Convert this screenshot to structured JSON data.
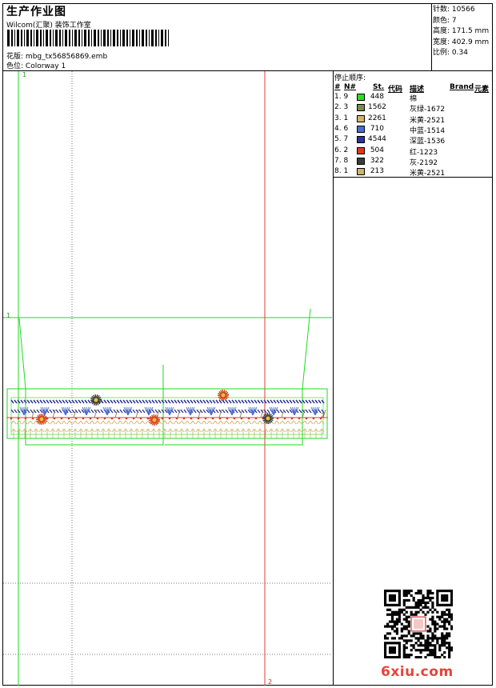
{
  "header": {
    "title": "生产作业图",
    "company": "Wilcom(汇聚) 装饰工作室",
    "file_label": "花版:",
    "file_name": "mbg_tx56856869.emb",
    "colorway_label": "色位:",
    "colorway_name": "Colorway 1"
  },
  "stats": [
    {
      "label": "针数:",
      "value": "10566"
    },
    {
      "label": "颜色:",
      "value": "7"
    },
    {
      "label": "高度:",
      "value": "171.5 mm"
    },
    {
      "label": "宽度:",
      "value": "402.9 mm"
    },
    {
      "label": "比例:",
      "value": "0.34"
    }
  ],
  "stop_sequence": {
    "title": "停止顺序:",
    "headers": {
      "hash": "#",
      "n": "N#",
      "st": "St.",
      "code": "代码",
      "desc": "描述",
      "brand": "Brand",
      "element": "元素"
    },
    "rows": [
      {
        "num": "1. 9",
        "color": "#22e02a",
        "st": "448",
        "desc": "棉"
      },
      {
        "num": "2. 3",
        "color": "#7d8a4f",
        "st": "1562",
        "desc": "灰绿-1672"
      },
      {
        "num": "3. 1",
        "color": "#d1b56b",
        "st": "2261",
        "desc": "米黄-2521"
      },
      {
        "num": "4. 6",
        "color": "#4a6ecf",
        "st": "710",
        "desc": "中蓝-1514"
      },
      {
        "num": "5. 7",
        "color": "#2c3495",
        "st": "4544",
        "desc": "深蓝-1536"
      },
      {
        "num": "6. 2",
        "color": "#d63c1b",
        "st": "504",
        "desc": "红-1223"
      },
      {
        "num": "7. 8",
        "color": "#3b3b3b",
        "st": "322",
        "desc": "灰-2192"
      },
      {
        "num": "8. 1",
        "color": "#c9b36e",
        "st": "213",
        "desc": "米黄-2521"
      }
    ]
  },
  "guides": {
    "v1": "1",
    "h1": "1",
    "v2": "2",
    "h2": "2"
  },
  "watermark": "6xiu.com"
}
